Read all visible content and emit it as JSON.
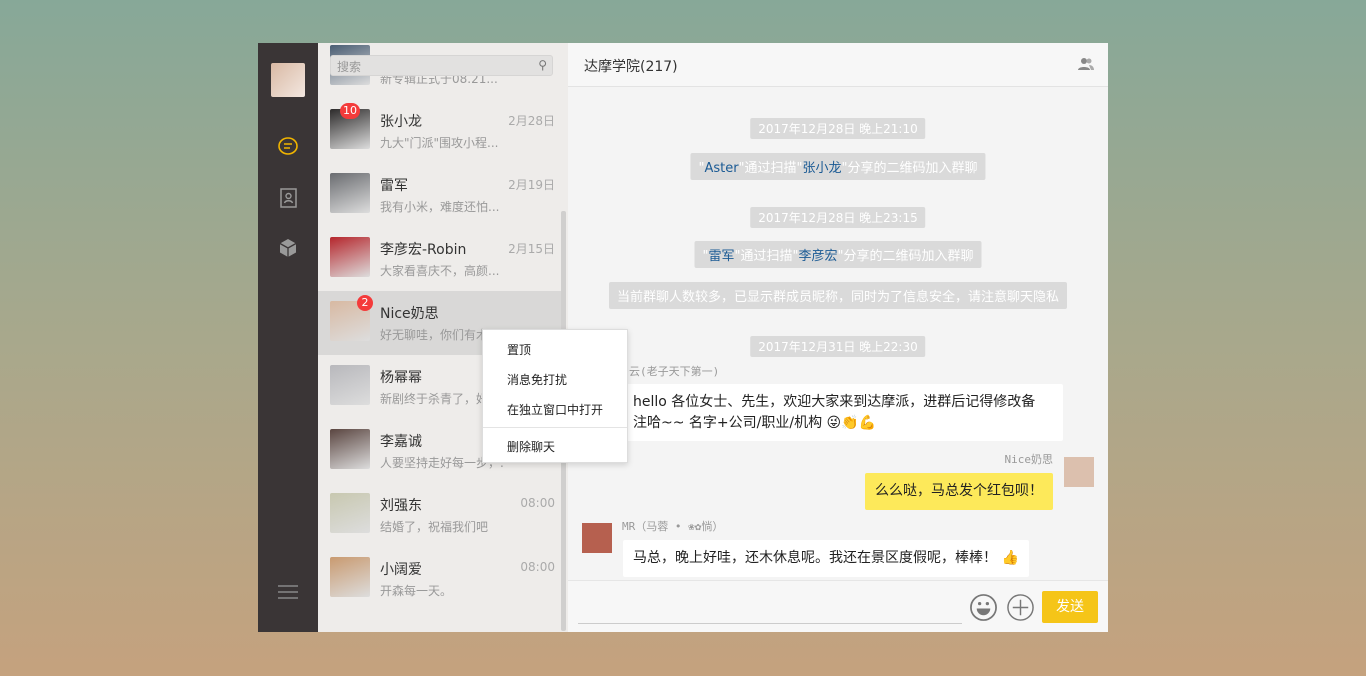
{
  "search": {
    "placeholder": "搜索"
  },
  "chats": [
    {
      "name": "",
      "preview": "新专辑正式于08.21...",
      "time": "",
      "badge": "",
      "color": "#4a5d73"
    },
    {
      "name": "张小龙",
      "preview": "九大\"门派\"围攻小程...",
      "time": "2月28日",
      "badge": "10",
      "color": "#2c2a2a"
    },
    {
      "name": "雷军",
      "preview": "我有小米，难度还怕...",
      "time": "2月19日",
      "badge": "",
      "color": "#6a6c70"
    },
    {
      "name": "李彦宏-Robin",
      "preview": "大家看喜庆不，高颜...",
      "time": "2月15日",
      "badge": "",
      "color": "#b5262c"
    },
    {
      "name": "Nice奶思",
      "preview": "好无聊哇，你们有木",
      "time": "",
      "badge": "2",
      "color": "#d8b9a2"
    },
    {
      "name": "杨幂幂",
      "preview": "新剧终于杀青了，好",
      "time": "",
      "badge": "",
      "color": "#b8b8bc"
    },
    {
      "name": "李嘉诚",
      "preview": "人要坚持走好每一步，...",
      "time": "",
      "badge": "",
      "color": "#5a4540"
    },
    {
      "name": "刘强东",
      "preview": "结婚了，祝福我们吧",
      "time": "08:00",
      "badge": "",
      "color": "#c8c8b0"
    },
    {
      "name": "小阔爱",
      "preview": "开森每一天。",
      "time": "08:00",
      "badge": "",
      "color": "#c99a70"
    }
  ],
  "context_menu": [
    "置顶",
    "消息免打扰",
    "在独立窗口中打开",
    "删除聊天"
  ],
  "chat": {
    "title": "达摩学院(217)",
    "notices": [
      {
        "type": "time",
        "text": "2017年12月28日 晚上21:10"
      },
      {
        "type": "join",
        "a": "Aster",
        "mid": "通过扫描",
        "b": "张小龙",
        "end": "分享的二维码加入群聊"
      },
      {
        "type": "time",
        "text": "2017年12月28日 晚上23:15"
      },
      {
        "type": "join",
        "a": "雷军",
        "mid": "通过扫描",
        "b": "李彦宏",
        "end": "分享的二维码加入群聊"
      },
      {
        "type": "info",
        "text": "当前群聊人数较多，已显示群成员昵称，同时为了信息安全，请注意聊天隐私"
      },
      {
        "type": "time",
        "text": "2017年12月31日 晚上22:30"
      }
    ],
    "messages": [
      {
        "sender": "马云(老子天下第一)",
        "line1": "hello 各位女士、先生，欢迎大家来到达摩派，进群后记得修改备",
        "line2": "注哈~~ 名字+公司/职业/机构 😜👏💪"
      },
      {
        "sender": "Nice奶思",
        "text": "么么哒，马总发个红包呗！"
      },
      {
        "sender": "MR（马蓉 • ❀✿惝）",
        "text": "马总，晚上好哇，还木休息呢。我还在景区度假呢，棒棒！ 👍"
      }
    ],
    "send_label": "发送"
  },
  "colors": {
    "accent": "#f5c518",
    "bubble_self": "#fde95a",
    "sidebar": "#3a3536"
  }
}
